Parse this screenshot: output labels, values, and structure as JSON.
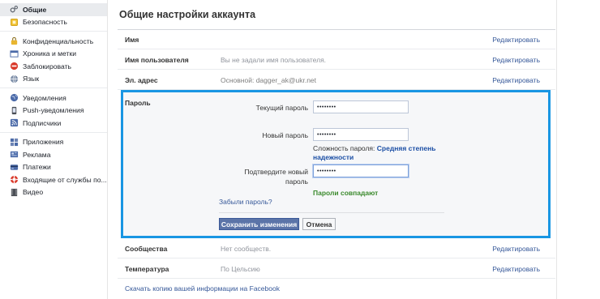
{
  "sidebar": {
    "groups": [
      {
        "items": [
          {
            "label": "Общие",
            "icon": "gear-icon",
            "active": true
          },
          {
            "label": "Безопасность",
            "icon": "shield-icon"
          }
        ]
      },
      {
        "items": [
          {
            "label": "Конфиденциальность",
            "icon": "lock-icon"
          },
          {
            "label": "Хроника и метки",
            "icon": "timeline-icon"
          },
          {
            "label": "Заблокировать",
            "icon": "block-icon"
          },
          {
            "label": "Язык",
            "icon": "globe-icon"
          }
        ]
      },
      {
        "items": [
          {
            "label": "Уведомления",
            "icon": "globe-icon"
          },
          {
            "label": "Push-уведомления",
            "icon": "phone-icon"
          },
          {
            "label": "Подписчики",
            "icon": "rss-icon"
          }
        ]
      },
      {
        "items": [
          {
            "label": "Приложения",
            "icon": "apps-icon"
          },
          {
            "label": "Реклама",
            "icon": "ads-icon"
          },
          {
            "label": "Платежи",
            "icon": "card-icon"
          },
          {
            "label": "Входящие от службы по...",
            "icon": "lifebuoy-icon"
          },
          {
            "label": "Видео",
            "icon": "film-icon"
          }
        ]
      }
    ]
  },
  "main": {
    "title": "Общие настройки аккаунта",
    "edit_label": "Редактировать",
    "rows_top": [
      {
        "label": "Имя",
        "value": ""
      },
      {
        "label": "Имя пользователя",
        "value": "Вы не задали имя пользователя."
      },
      {
        "label": "Эл. адрес",
        "value": "Основной: dagger_ak@ukr.net"
      }
    ],
    "password": {
      "label": "Пароль",
      "current_label": "Текущий пароль",
      "current_value": "••••••••",
      "new_label": "Новый пароль",
      "new_value": "••••••••",
      "strength_prefix": "Сложность пароля:",
      "strength_value": "Средняя степень надежности",
      "confirm_label": "Подтвердите новый пароль",
      "confirm_value": "••••••••",
      "match_text": "Пароли совпадают",
      "forgot_link": "Забыли пароль?",
      "save_button": "Сохранить изменения",
      "cancel_button": "Отмена"
    },
    "rows_bottom": [
      {
        "label": "Сообщества",
        "value": "Нет сообществ."
      },
      {
        "label": "Температура",
        "value": "По Цельсию"
      }
    ],
    "download_link": "Скачать копию вашей информации на Facebook"
  },
  "colors": {
    "accent_border": "#1996e3",
    "link": "#365899",
    "save_button": "#5b74a8",
    "success": "#3b8a2d"
  }
}
